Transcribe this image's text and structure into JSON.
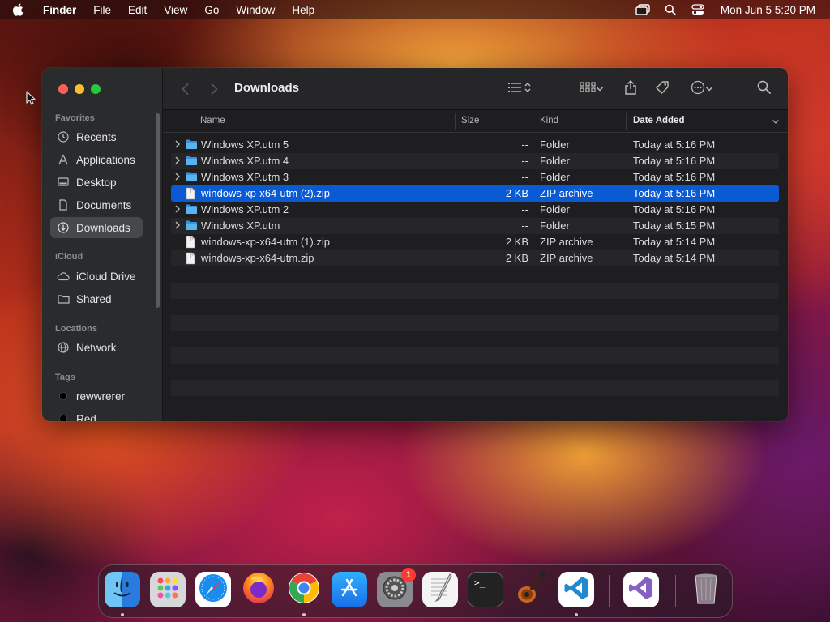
{
  "menubar": {
    "app_name": "Finder",
    "menus": [
      "File",
      "Edit",
      "View",
      "Go",
      "Window",
      "Help"
    ],
    "clock": "Mon Jun 5  5:20 PM",
    "status_icons": [
      "screen-mirroring-icon",
      "spotlight-search-icon",
      "control-center-icon"
    ]
  },
  "window": {
    "title": "Downloads",
    "sidebar": {
      "favorites_label": "Favorites",
      "favorites": [
        {
          "label": "Recents",
          "icon": "clock-icon"
        },
        {
          "label": "Applications",
          "icon": "applications-icon"
        },
        {
          "label": "Desktop",
          "icon": "desktop-icon"
        },
        {
          "label": "Documents",
          "icon": "document-icon"
        },
        {
          "label": "Downloads",
          "icon": "download-icon",
          "selected": true
        }
      ],
      "icloud_label": "iCloud",
      "icloud": [
        {
          "label": "iCloud Drive",
          "icon": "cloud-icon"
        },
        {
          "label": "Shared",
          "icon": "shared-folder-icon"
        }
      ],
      "locations_label": "Locations",
      "locations": [
        {
          "label": "Network",
          "icon": "globe-icon"
        }
      ],
      "tags_label": "Tags",
      "tags": [
        {
          "label": "rewwrerer",
          "color": "#000000"
        },
        {
          "label": "Red",
          "color": "#000000"
        }
      ]
    },
    "columns": {
      "name": "Name",
      "size": "Size",
      "kind": "Kind",
      "date_added": "Date Added"
    },
    "files": [
      {
        "name": "Windows XP.utm 5",
        "size": "--",
        "kind": "Folder",
        "date": "Today at 5:16 PM",
        "type": "folder"
      },
      {
        "name": "Windows XP.utm 4",
        "size": "--",
        "kind": "Folder",
        "date": "Today at 5:16 PM",
        "type": "folder"
      },
      {
        "name": "Windows XP.utm 3",
        "size": "--",
        "kind": "Folder",
        "date": "Today at 5:16 PM",
        "type": "folder"
      },
      {
        "name": "windows-xp-x64-utm (2).zip",
        "size": "2 KB",
        "kind": "ZIP archive",
        "date": "Today at 5:16 PM",
        "type": "file",
        "selected": true
      },
      {
        "name": "Windows XP.utm 2",
        "size": "--",
        "kind": "Folder",
        "date": "Today at 5:16 PM",
        "type": "folder"
      },
      {
        "name": "Windows XP.utm",
        "size": "--",
        "kind": "Folder",
        "date": "Today at 5:15 PM",
        "type": "folder"
      },
      {
        "name": "windows-xp-x64-utm (1).zip",
        "size": "2 KB",
        "kind": "ZIP archive",
        "date": "Today at 5:14 PM",
        "type": "file"
      },
      {
        "name": "windows-xp-x64-utm.zip",
        "size": "2 KB",
        "kind": "ZIP archive",
        "date": "Today at 5:14 PM",
        "type": "file"
      }
    ]
  },
  "dock": {
    "apps": [
      "finder",
      "launchpad",
      "safari",
      "firefox",
      "chrome",
      "app-store",
      "system-settings",
      "textedit",
      "terminal",
      "garageband",
      "visual-studio-code",
      "visual-studio",
      "trash"
    ],
    "system_settings_badge": "1",
    "terminal_prompt": ">_"
  },
  "colors": {
    "selection": "#0a5ad4",
    "folder": "#4aa8e8",
    "close": "#fe5f57",
    "minimize": "#febc2e",
    "zoom": "#28c840"
  }
}
